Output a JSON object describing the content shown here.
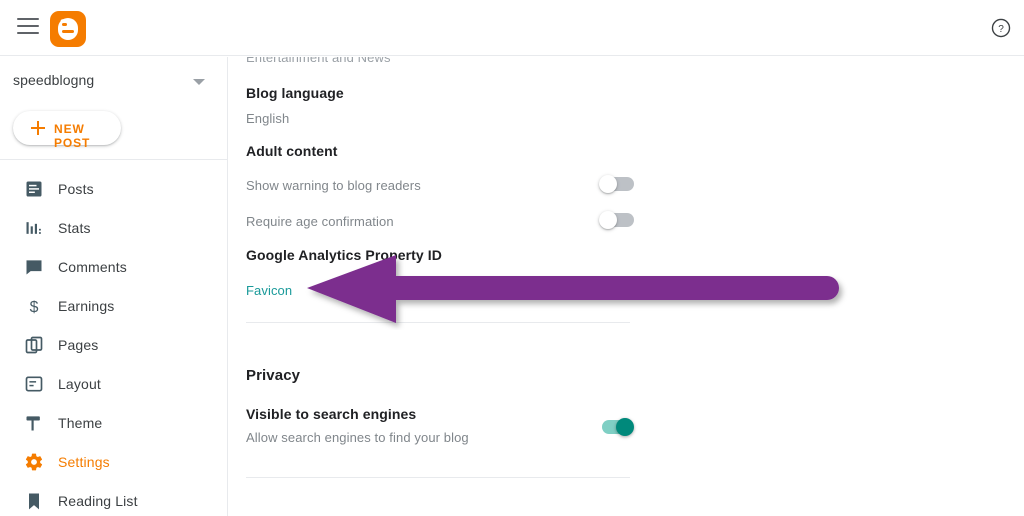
{
  "topbar": {
    "menu_icon": "hamburger-menu-icon",
    "logo_icon": "blogger-logo-icon",
    "help_icon": "help-circle-icon"
  },
  "sidebar": {
    "blog_name": "speedblogng",
    "blog_caret_icon": "chevron-down-icon",
    "new_post": {
      "label": "NEW POST",
      "plus_icon": "plus-icon"
    },
    "items": [
      {
        "label": "Posts",
        "icon": "posts-icon",
        "active": false
      },
      {
        "label": "Stats",
        "icon": "stats-bar-chart-icon",
        "active": false
      },
      {
        "label": "Comments",
        "icon": "comments-bubble-icon",
        "active": false
      },
      {
        "label": "Earnings",
        "icon": "earnings-dollar-icon",
        "active": false
      },
      {
        "label": "Pages",
        "icon": "pages-copy-icon",
        "active": false
      },
      {
        "label": "Layout",
        "icon": "layout-icon",
        "active": false
      },
      {
        "label": "Theme",
        "icon": "theme-roller-icon",
        "active": false
      },
      {
        "label": "Settings",
        "icon": "settings-gear-icon",
        "active": true
      },
      {
        "label": "Reading List",
        "icon": "reading-list-bookmark-icon",
        "active": false
      }
    ]
  },
  "content": {
    "scrolled_partial_label": "Entertainment and News",
    "blog_language": {
      "heading": "Blog language",
      "value": "English"
    },
    "adult_content": {
      "heading": "Adult content",
      "rows": [
        {
          "label": "Show warning to blog readers",
          "state": "off"
        },
        {
          "label": "Require age confirmation",
          "state": "off"
        }
      ]
    },
    "google_analytics": {
      "heading": "Google Analytics Property ID"
    },
    "favicon": {
      "link_label": "Favicon"
    },
    "privacy": {
      "section_title": "Privacy",
      "rows": [
        {
          "label": "Visible to search engines",
          "description": "Allow search engines to find your blog",
          "state": "on"
        }
      ]
    }
  },
  "annotation": {
    "type": "arrow",
    "direction": "left",
    "color": "#7b2d8e",
    "points_to": "Favicon"
  },
  "colors": {
    "brand_orange": "#f57c00",
    "toggle_on_teal": "#00897b",
    "link_teal": "#1a9a9a",
    "annotation_purple": "#7b2d8e",
    "text_primary": "#202124",
    "text_secondary": "#80868b",
    "divider": "#e8eaed"
  }
}
